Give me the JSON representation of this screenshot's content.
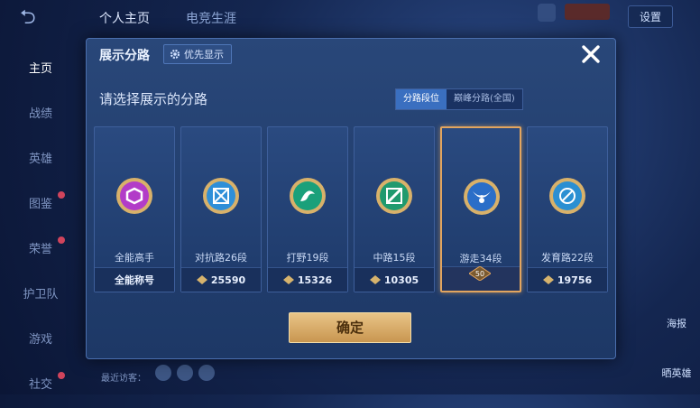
{
  "background": {
    "top_tabs": [
      "个人主页",
      "电竞生涯"
    ],
    "side_nav": [
      {
        "label": "主页",
        "active": true,
        "dot": false
      },
      {
        "label": "战绩",
        "active": false,
        "dot": false
      },
      {
        "label": "英雄",
        "active": false,
        "dot": false
      },
      {
        "label": "图鉴",
        "active": false,
        "dot": true
      },
      {
        "label": "荣誉",
        "active": false,
        "dot": true
      },
      {
        "label": "护卫队",
        "active": false,
        "dot": false
      },
      {
        "label": "游戏",
        "active": false,
        "dot": false
      },
      {
        "label": "社交",
        "active": false,
        "dot": true
      }
    ],
    "settings_label": "设置",
    "visit_label": "最近访客：",
    "right_badges": [
      "海报",
      "晒英雄"
    ]
  },
  "modal": {
    "title": "展示分路",
    "priority_label": "优先显示",
    "prompt": "请选择展示的分路",
    "toggle": [
      {
        "label": "分路段位",
        "active": true
      },
      {
        "label": "巅峰分路(全国)",
        "active": false
      }
    ],
    "cards": [
      {
        "title": "全能高手",
        "footer": "全能称号",
        "score_icon": false,
        "emblem_color": "#b23cc8",
        "selected": false
      },
      {
        "title": "对抗路26段",
        "footer": "25590",
        "score_icon": true,
        "emblem_color": "#2f8fd8",
        "selected": false
      },
      {
        "title": "打野19段",
        "footer": "15326",
        "score_icon": true,
        "emblem_color": "#1aa07a",
        "selected": false
      },
      {
        "title": "中路15段",
        "footer": "10305",
        "score_icon": true,
        "emblem_color": "#1f9a6e",
        "selected": false
      },
      {
        "title": "游走34段",
        "footer": "",
        "score_icon": false,
        "emblem_color": "#2a6ec8",
        "selected": true,
        "rank_badge": "50"
      },
      {
        "title": "发育路22段",
        "footer": "19756",
        "score_icon": true,
        "emblem_color": "#2b8fd2",
        "selected": false
      }
    ],
    "confirm_label": "确定"
  },
  "colors": {
    "accent_gold": "#e2a55f",
    "toggle_active": "#3a6fc0"
  }
}
